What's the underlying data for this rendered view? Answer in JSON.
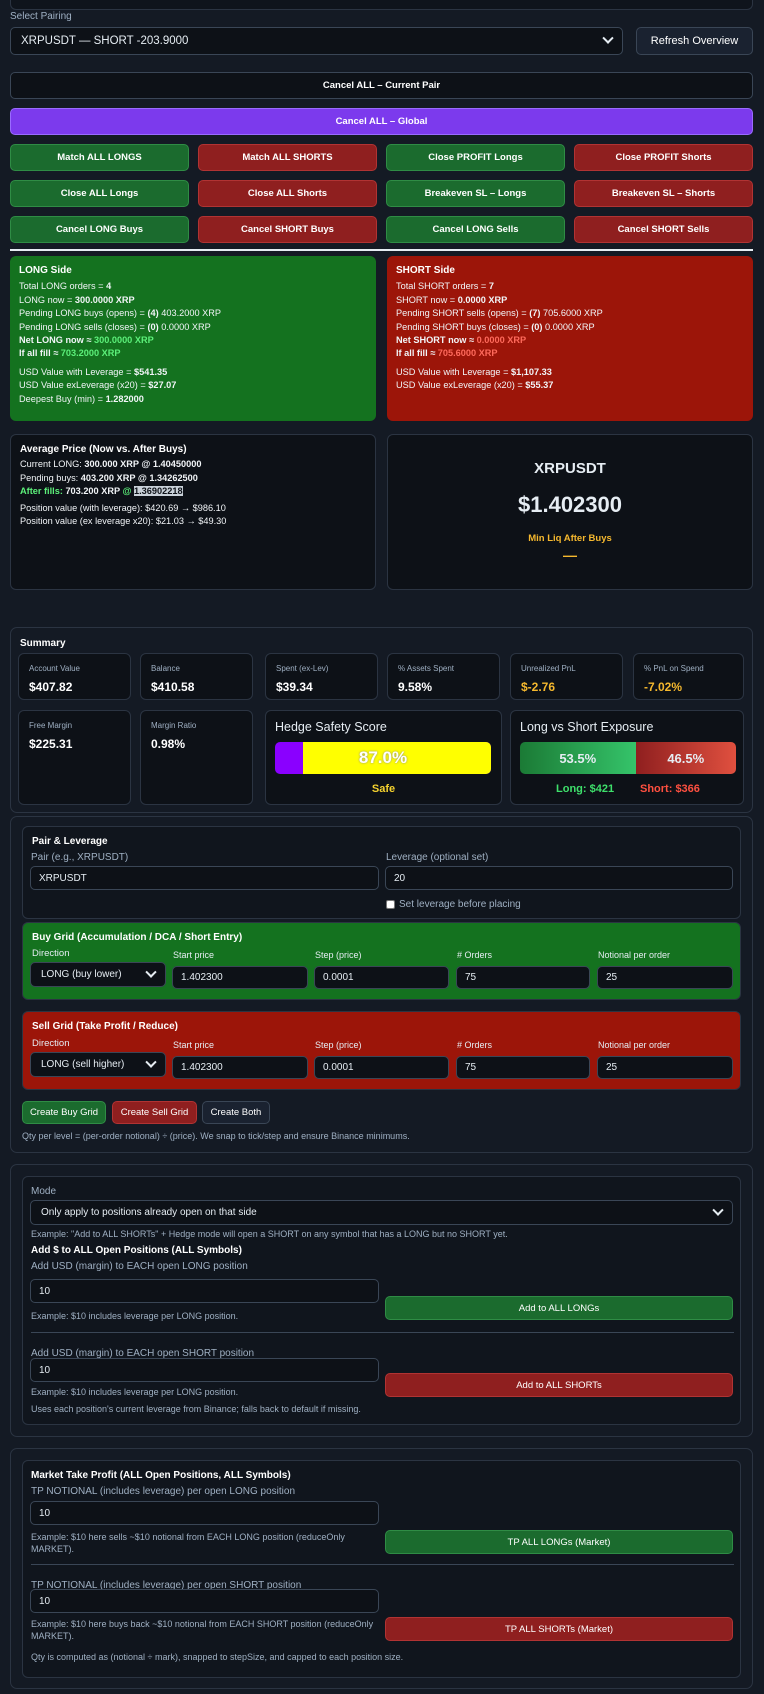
{
  "select_pairing": {
    "label": "Select Pairing",
    "value": "XRPUSDT — SHORT -203.9000",
    "refresh": "Refresh Overview"
  },
  "actions": {
    "cancel_current": "Cancel ALL – Current Pair",
    "cancel_global": "Cancel ALL – Global",
    "grid": [
      [
        "Match ALL LONGS",
        "Match ALL SHORTS",
        "Close PROFIT Longs",
        "Close PROFIT Shorts"
      ],
      [
        "Close ALL Longs",
        "Close ALL Shorts",
        "Breakeven SL – Longs",
        "Breakeven SL – Shorts"
      ],
      [
        "Cancel LONG Buys",
        "Cancel SHORT Buys",
        "Cancel LONG Sells",
        "Cancel SHORT Sells"
      ]
    ]
  },
  "long_side": {
    "title": "LONG Side",
    "total_pre": "Total LONG orders = ",
    "total": "4",
    "now_pre": "LONG now = ",
    "now": "300.0000 XRP",
    "pend_buys_pre": "Pending LONG buys (opens) = ",
    "pend_buys_n": "(4)",
    "pend_buys": " 403.2000 XRP",
    "pend_sells_pre": "Pending LONG sells (closes) = ",
    "pend_sells_n": "(0)",
    "pend_sells": " 0.0000 XRP",
    "net_pre": "Net LONG now ≈ ",
    "net": "300.0000 XRP",
    "fill_pre": "If all fill ≈ ",
    "fill": "703.2000 XRP",
    "usd_lev_pre": "USD Value with Leverage = ",
    "usd_lev": "$541.35",
    "usd_ex_pre": "USD Value exLeverage (x20) = ",
    "usd_ex": "$27.07",
    "deep_pre": "Deepest Buy (min) = ",
    "deep": "1.282000"
  },
  "short_side": {
    "title": "SHORT Side",
    "total_pre": "Total SHORT orders = ",
    "total": "7",
    "now_pre": "SHORT now = ",
    "now": "0.0000 XRP",
    "pend_sells_pre": "Pending SHORT sells (opens) = ",
    "pend_sells_n": "(7)",
    "pend_sells": " 705.6000 XRP",
    "pend_buys_pre": "Pending SHORT buys (closes) = ",
    "pend_buys_n": "(0)",
    "pend_buys": " 0.0000 XRP",
    "net_pre": "Net SHORT now ≈ ",
    "net": "0.0000 XRP",
    "fill_pre": "If all fill ≈ ",
    "fill": "705.6000 XRP",
    "usd_lev_pre": "USD Value with Leverage = ",
    "usd_lev": "$1,107.33",
    "usd_ex_pre": "USD Value exLeverage (x20) = ",
    "usd_ex": "$55.37"
  },
  "avg_price": {
    "title": "Average Price (Now vs. After Buys)",
    "current_pre": "Current LONG: ",
    "current": "300.000 XRP @ 1.40450000",
    "pending_pre": "Pending buys: ",
    "pending": "403.200 XRP @ 1.34262500",
    "after_pre": "After fills: ",
    "after_qty": "703.200 XRP",
    "after_at": " @ ",
    "after_px": "1.36902218",
    "pos_lev": "Position value (with leverage): $420.69 → $986.10",
    "pos_ex": "Position value (ex leverage x20): $21.03 → $49.30"
  },
  "ticker": {
    "symbol": "XRPUSDT",
    "price": "$1.402300",
    "min_liq": "Min Liq After Buys",
    "min_liq_val": "—"
  },
  "summary": {
    "title": "Summary",
    "cards": [
      {
        "label": "Account Value",
        "value": "$407.82",
        "color": "#ffffff"
      },
      {
        "label": "Balance",
        "value": "$410.58",
        "color": "#ffffff"
      },
      {
        "label": "Spent (ex-Lev)",
        "value": "$39.34",
        "color": "#ffffff"
      },
      {
        "label": "% Assets Spent",
        "value": "9.58%",
        "color": "#ffffff"
      },
      {
        "label": "Unrealized PnL",
        "value": "$-2.76",
        "color": "#f5b82e"
      },
      {
        "label": "% PnL on Spend",
        "value": "-7.02%",
        "color": "#f5b82e"
      },
      {
        "label": "Free Margin",
        "value": "$225.31",
        "color": "#ffffff"
      },
      {
        "label": "Margin Ratio",
        "value": "0.98%",
        "color": "#ffffff"
      }
    ],
    "hedge": {
      "title": "Hedge Safety Score",
      "score": "87.0%",
      "score_fraction": 0.87,
      "status": "Safe"
    },
    "exposure": {
      "title": "Long vs Short Exposure",
      "long_pct": "53.5%",
      "short_pct": "46.5%",
      "long_fraction": 0.535,
      "long_label": "Long: $421",
      "short_label": "Short: $366"
    }
  },
  "pair_lev": {
    "title": "Pair & Leverage",
    "pair_label": "Pair (e.g., XRPUSDT)",
    "pair_value": "XRPUSDT",
    "lev_label": "Leverage (optional set)",
    "lev_value": "20",
    "set_lev": "Set leverage before placing"
  },
  "buy_grid": {
    "title": "Buy Grid (Accumulation / DCA / Short Entry)",
    "direction_label": "Direction",
    "direction": "LONG (buy lower)",
    "start_label": "Start price",
    "start": "1.402300",
    "step_label": "Step (price)",
    "step": "0.0001",
    "orders_label": "# Orders",
    "orders": "75",
    "notional_label": "Notional per order",
    "notional": "25"
  },
  "sell_grid": {
    "title": "Sell Grid (Take Profit / Reduce)",
    "direction_label": "Direction",
    "direction": "LONG (sell higher)",
    "start_label": "Start price",
    "start": "1.402300",
    "step_label": "Step (price)",
    "step": "0.0001",
    "orders_label": "# Orders",
    "orders": "75",
    "notional_label": "Notional per order",
    "notional": "25"
  },
  "grid_buttons": {
    "buy": "Create Buy Grid",
    "sell": "Create Sell Grid",
    "both": "Create Both",
    "note": "Qty per level = (per-order notional) ÷ (price). We snap to tick/step and ensure Binance minimums."
  },
  "add_usd": {
    "mode_label": "Mode",
    "mode": "Only apply to positions already open on that side",
    "mode_note": "Example: \"Add to ALL SHORTs\" + Hedge mode will open a SHORT on any symbol that has a LONG but no SHORT yet.",
    "title": "Add $ to ALL Open Positions (ALL Symbols)",
    "long_label": "Add USD (margin) to EACH open LONG position",
    "long_value": "10",
    "long_note": "Example: $10 includes leverage per LONG position.",
    "long_btn": "Add to ALL LONGs",
    "short_label": "Add USD (margin) to EACH open SHORT position",
    "short_value": "10",
    "short_note": "Example: $10 includes leverage per LONG position.",
    "short_btn": "Add to ALL SHORTs",
    "footer": "Uses each position's current leverage from Binance; falls back to default if missing."
  },
  "tp": {
    "title": "Market Take Profit (ALL Open Positions, ALL Symbols)",
    "long_label": "TP NOTIONAL (includes leverage) per open LONG position",
    "long_value": "10",
    "long_note1": "Example: $10 here sells ~$10 notional from EACH LONG position (reduceOnly",
    "long_note2": "MARKET).",
    "long_btn": "TP ALL LONGs (Market)",
    "short_label": "TP NOTIONAL (includes leverage) per open SHORT position",
    "short_value": "10",
    "short_note1": "Example: $10 here buys back ~$10 notional from EACH SHORT position (reduceOnly",
    "short_note2": "MARKET).",
    "short_btn": "TP ALL SHORTs (Market)",
    "footer": "Qty is computed as (notional ÷ mark), snapped to stepSize, and capped to each position size."
  }
}
